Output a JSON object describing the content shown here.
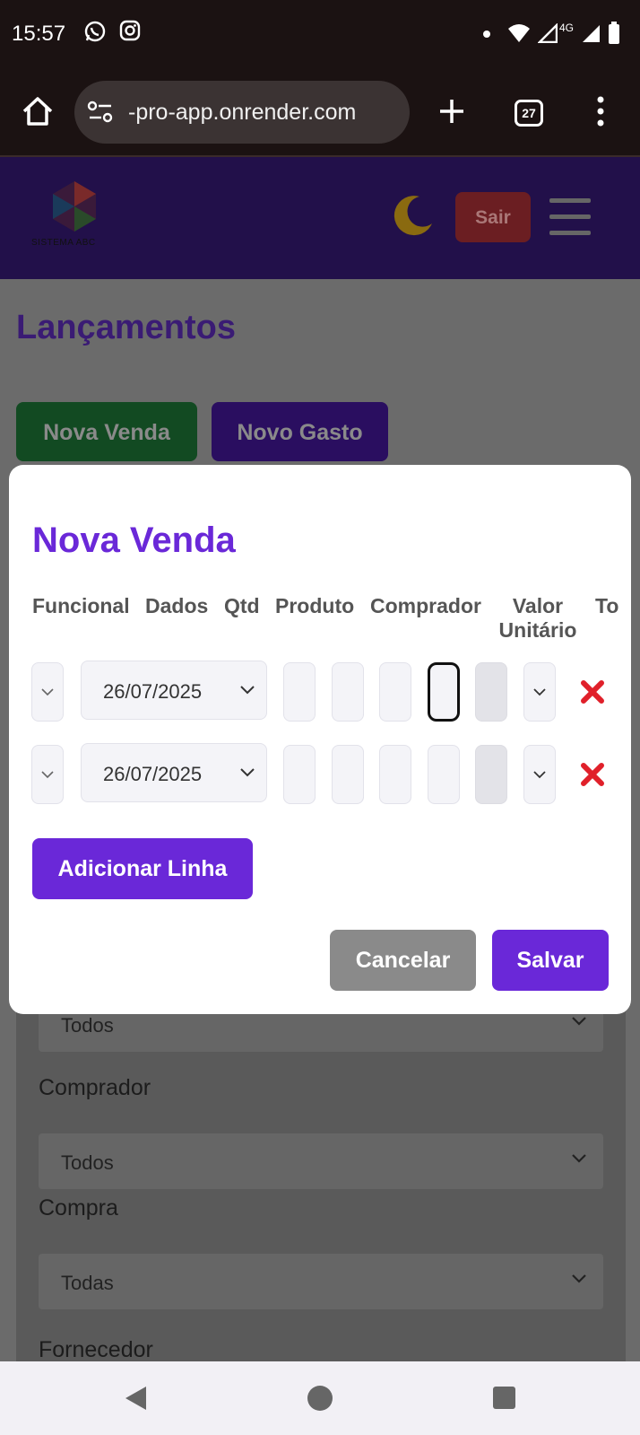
{
  "status_bar": {
    "time": "15:57",
    "network": "4G"
  },
  "browser": {
    "url": "-pro-app.onrender.com",
    "tabs_count": "27"
  },
  "app_header": {
    "logo_text": "SISTEMA ABC",
    "logout_label": "Sair"
  },
  "page": {
    "title": "Lançamentos",
    "new_sale_label": "Nova Venda",
    "new_expense_label": "Novo Gasto",
    "filters": [
      {
        "label": "",
        "value": "Todos"
      },
      {
        "label": "Comprador",
        "value": "Todos"
      },
      {
        "label": "Compra",
        "value": "Todas"
      },
      {
        "label": "Fornecedor",
        "value": ""
      }
    ]
  },
  "modal": {
    "title": "Nova Venda",
    "columns": [
      "Funcional",
      "Dados",
      "Qtd",
      "Produto",
      "Comprador",
      "Valor Unitário",
      "To"
    ],
    "rows": [
      {
        "date": "26/07/2025"
      },
      {
        "date": "26/07/2025"
      }
    ],
    "add_line_label": "Adicionar Linha",
    "cancel_label": "Cancelar",
    "save_label": "Salvar"
  },
  "colors": {
    "accent": "#6a28d8",
    "header_bg": "#22104a",
    "delete": "#e0202a"
  },
  "icons": [
    "home-icon",
    "site-info-icon",
    "new-tab-icon",
    "tabs-icon",
    "more-vert-icon",
    "moon-icon",
    "hamburger-icon",
    "chevron-down-icon",
    "close-x-icon",
    "back-icon",
    "home-circle-icon",
    "recents-icon"
  ]
}
